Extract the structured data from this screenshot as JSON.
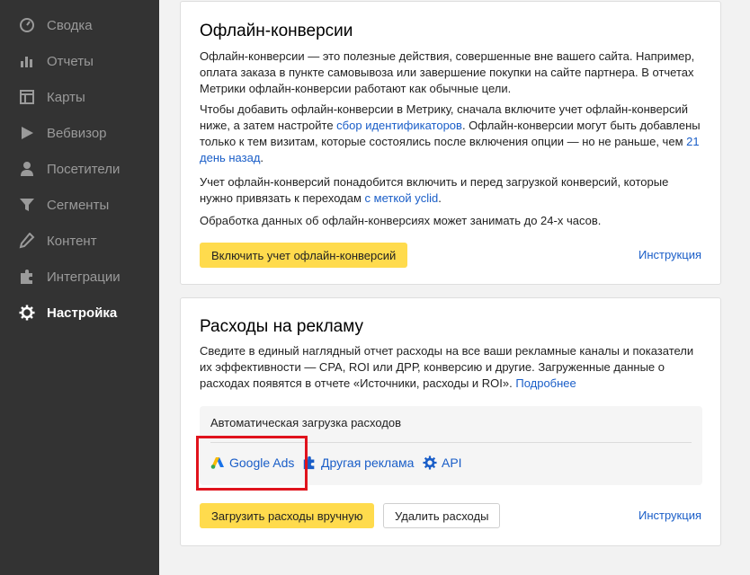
{
  "sidebar": {
    "items": [
      {
        "label": "Сводка",
        "icon": "gauge-icon"
      },
      {
        "label": "Отчеты",
        "icon": "bar-chart-icon"
      },
      {
        "label": "Карты",
        "icon": "map-layout-icon"
      },
      {
        "label": "Вебвизор",
        "icon": "play-icon"
      },
      {
        "label": "Посетители",
        "icon": "person-icon"
      },
      {
        "label": "Сегменты",
        "icon": "funnel-icon"
      },
      {
        "label": "Контент",
        "icon": "pencil-icon"
      },
      {
        "label": "Интеграции",
        "icon": "puzzle-icon"
      },
      {
        "label": "Настройка",
        "icon": "gear-icon",
        "active": true
      }
    ]
  },
  "offline": {
    "title": "Офлайн-конверсии",
    "p1": "Офлайн-конверсии — это полезные действия, совершенные вне вашего сайта. Например, оплата заказа в пункте самовывоза или завершение покупки на сайте партнера. В отчетах Метрики офлайн-конверсии работают как обычные цели.",
    "p2_a": "Чтобы добавить офлайн-конверсии в Метрику, сначала включите учет офлайн-конверсий ниже, а затем настройте ",
    "p2_link1": "сбор идентификаторов",
    "p2_b": ". Офлайн-конверсии могут быть добавлены только к тем визитам, которые состоялись после включения опции — но не раньше, чем ",
    "p2_link2": "21 день назад",
    "p2_c": ".",
    "p3_a": "Учет офлайн-конверсий понадобится включить и перед загрузкой конверсий, которые нужно привязать к переходам ",
    "p3_link": "с меткой yclid",
    "p3_b": ".",
    "p4": "Обработка данных об офлайн-конверсиях может занимать до 24-х часов.",
    "enable_button": "Включить учет офлайн-конверсий",
    "instruction_link": "Инструкция"
  },
  "expenses": {
    "title": "Расходы на рекламу",
    "p1_a": "Сведите в единый наглядный отчет расходы на все ваши рекламные каналы и показатели их эффективности — CPA, ROI или ДРР, конверсию и другие. Загруженные данные о расходах появятся в отчете «Источники, расходы и ROI». ",
    "p1_link": "Подробнее",
    "auto_title": "Автоматическая загрузка расходов",
    "sources": [
      {
        "label": "Google Ads",
        "icon": "google-ads-icon"
      },
      {
        "label": "Другая реклама",
        "icon": "puzzle-icon"
      },
      {
        "label": "API",
        "icon": "gear-icon"
      }
    ],
    "upload_button": "Загрузить расходы вручную",
    "delete_button": "Удалить расходы",
    "instruction_link": "Инструкция"
  },
  "colors": {
    "sidebar_bg": "#333333",
    "accent_yellow": "#ffdb4d",
    "link_blue": "#1a5ec8",
    "highlight_red": "#e0131d"
  }
}
